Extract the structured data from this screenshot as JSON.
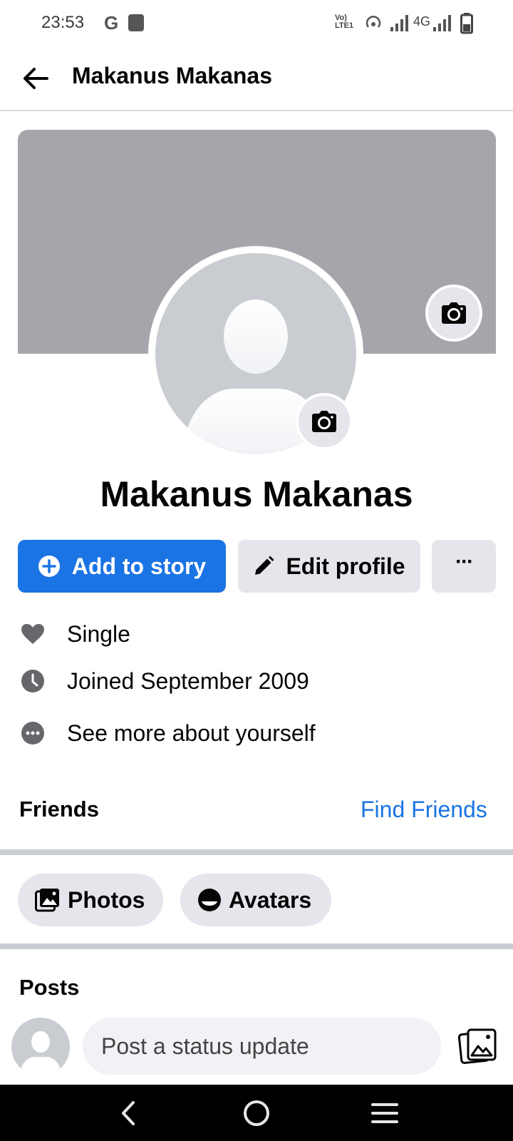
{
  "status_bar": {
    "time": "23:53",
    "google_label": "G",
    "network_label": "4G",
    "lte_label": "Vo) LTE1"
  },
  "header": {
    "title": "Makanus Makanas"
  },
  "profile": {
    "name": "Makanus Makanas"
  },
  "actions": {
    "add_story_label": "Add to story",
    "edit_profile_label": "Edit profile",
    "more_label": "···"
  },
  "info": {
    "relationship": "Single",
    "joined": "Joined September 2009",
    "see_more": "See more about yourself"
  },
  "friends": {
    "title": "Friends",
    "find_friends_label": "Find Friends"
  },
  "chips": {
    "photos_label": "Photos",
    "avatars_label": "Avatars"
  },
  "posts": {
    "title": "Posts",
    "composer_placeholder": "Post a status update"
  },
  "colors": {
    "accent": "#1b74e4",
    "button_gray": "#e4e6eb",
    "cover_gray": "#a4a6ab"
  }
}
